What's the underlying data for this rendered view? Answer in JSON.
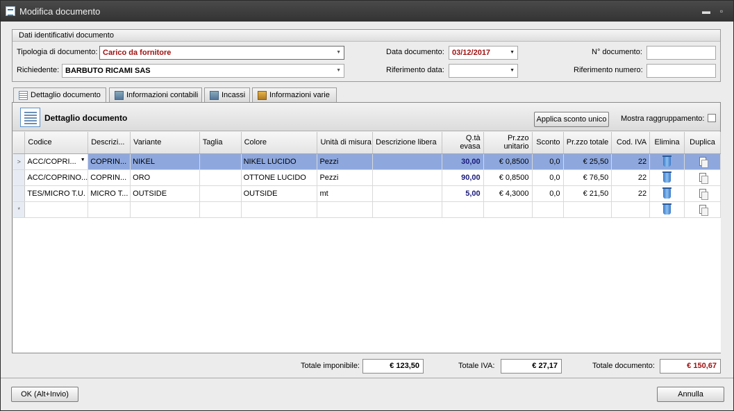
{
  "window": {
    "title": "Modifica documento",
    "controls": [
      "minimize-icon",
      "maximize-icon"
    ]
  },
  "group": {
    "title": "Dati identificativi documento",
    "tipologia": {
      "label": "Tipologia di documento:",
      "value": "Carico da fornitore"
    },
    "richiedente": {
      "label": "Richiedente:",
      "value": "BARBUTO RICAMI SAS"
    },
    "data_documento": {
      "label": "Data documento:",
      "value": "03/12/2017"
    },
    "riferimento_data": {
      "label": "Riferimento data:",
      "value": ""
    },
    "n_documento": {
      "label": "N° documento:",
      "value": ""
    },
    "riferimento_numero": {
      "label": "Riferimento numero:",
      "value": ""
    }
  },
  "tabs": [
    {
      "label": "Dettaglio documento",
      "icon": "list-icon",
      "active": true
    },
    {
      "label": "Informazioni contabili",
      "icon": "calculator-icon"
    },
    {
      "label": "Incassi",
      "icon": "calculator-icon"
    },
    {
      "label": "Informazioni varie",
      "icon": "box-icon"
    }
  ],
  "panel": {
    "title": "Dettaglio documento",
    "apply_discount_button": "Applica sconto unico",
    "show_grouping_label": "Mostra raggruppamento:",
    "show_grouping_checked": false
  },
  "grid": {
    "columns": [
      "Codice",
      "Descrizi...",
      "Variante",
      "Taglia",
      "Colore",
      "Unità di misura",
      "Descrizione libera",
      "Q.tà evasa",
      "Pr.zzo unitario",
      "Sconto",
      "Pr.zzo totale",
      "Cod. IVA",
      "Elimina",
      "Duplica"
    ],
    "rows": [
      {
        "codice": "ACC/COPRI...",
        "descr": "COPRIN...",
        "variante": "NIKEL",
        "taglia": "",
        "colore": "NIKEL LUCIDO",
        "um": "Pezzi",
        "descr_libera": "",
        "qta": "30,00",
        "prezzo": "€ 0,8500",
        "sconto": "0,0",
        "totale": "€ 25,50",
        "iva": "22"
      },
      {
        "codice": "ACC/COPRINO...",
        "descr": "COPRIN...",
        "variante": "ORO",
        "taglia": "",
        "colore": "OTTONE LUCIDO",
        "um": "Pezzi",
        "descr_libera": "",
        "qta": "90,00",
        "prezzo": "€ 0,8500",
        "sconto": "0,0",
        "totale": "€ 76,50",
        "iva": "22"
      },
      {
        "codice": "TES/MICRO T.U.",
        "descr": "MICRO T...",
        "variante": "OUTSIDE",
        "taglia": "",
        "colore": "OUTSIDE",
        "um": "mt",
        "descr_libera": "",
        "qta": "5,00",
        "prezzo": "€ 4,3000",
        "sconto": "0,0",
        "totale": "€ 21,50",
        "iva": "22"
      }
    ],
    "new_row_marker": "*"
  },
  "totals": {
    "imponibile_label": "Totale imponibile:",
    "imponibile": "€ 123,50",
    "iva_label": "Totale IVA:",
    "iva": "€ 27,17",
    "documento_label": "Totale documento:",
    "documento": "€ 150,67"
  },
  "footer": {
    "ok_button": "OK (Alt+Invio)",
    "cancel_button": "Annulla"
  },
  "colors": {
    "accent_red": "#a01010",
    "row_highlight": "#8ea8de",
    "qty_blue": "#1a1a7a"
  }
}
